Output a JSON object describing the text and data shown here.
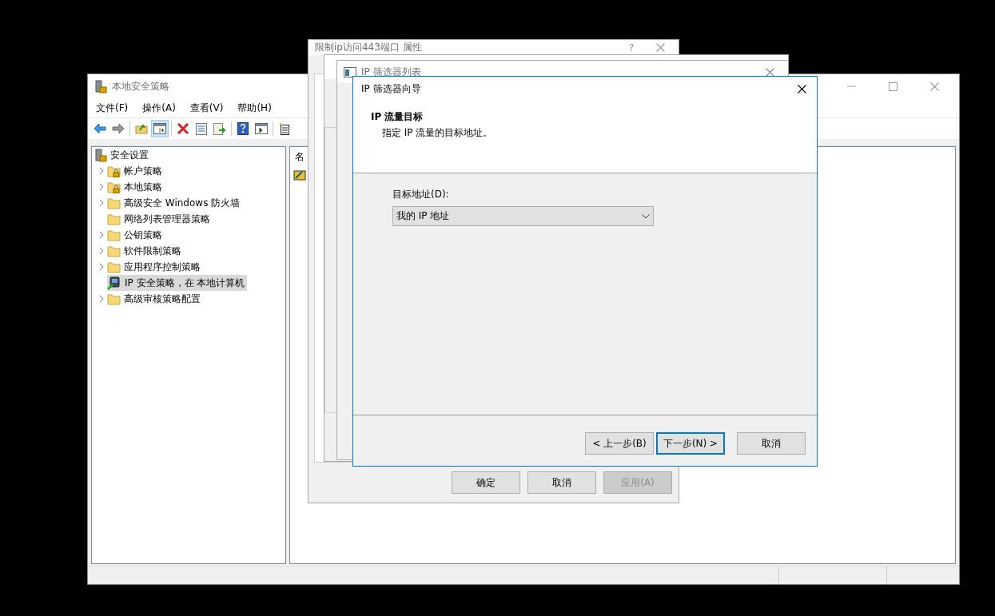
{
  "main_window": {
    "title": "本地安全策略",
    "menu": [
      "文件(F)",
      "操作(A)",
      "查看(V)",
      "帮助(H)"
    ],
    "tree": {
      "label": "安全设置",
      "children": [
        {
          "label": "帐户策略",
          "kind": "locked-folder",
          "expandable": true,
          "selected": false
        },
        {
          "label": "本地策略",
          "kind": "locked-folder",
          "expandable": true,
          "selected": false
        },
        {
          "label": "高级安全 Windows 防火墙",
          "kind": "folder",
          "expandable": true,
          "selected": false
        },
        {
          "label": "网络列表管理器策略",
          "kind": "folder",
          "expandable": false,
          "selected": false
        },
        {
          "label": "公钥策略",
          "kind": "folder",
          "expandable": true,
          "selected": false
        },
        {
          "label": "软件限制策略",
          "kind": "folder",
          "expandable": true,
          "selected": false
        },
        {
          "label": "应用程序控制策略",
          "kind": "folder",
          "expandable": true,
          "selected": false
        },
        {
          "label": "IP 安全策略，在 本地计算机",
          "kind": "ip-policy",
          "expandable": false,
          "selected": true
        },
        {
          "label": "高级审核策略配置",
          "kind": "folder",
          "expandable": true,
          "selected": false
        }
      ]
    },
    "list_column": "名"
  },
  "properties_dialog": {
    "title": "限制ip访问443端口 属性",
    "help": "?",
    "buttons": [
      {
        "label": "确定",
        "disabled": false
      },
      {
        "label": "取消",
        "disabled": false
      },
      {
        "label": "应用(A)",
        "disabled": true
      }
    ]
  },
  "filter_list_dialog": {
    "title": "IP 筛选器列表"
  },
  "wizard": {
    "title": "IP 筛选器向导",
    "heading": "IP 流量目标",
    "subheading": "指定 IP 流量的目标地址。",
    "field": {
      "label": "目标地址(D):",
      "value": "我的 IP 地址"
    },
    "buttons": [
      {
        "label": "< 上一步(B)",
        "focused": false
      },
      {
        "label": "下一步(N) >",
        "focused": true
      },
      {
        "label": "取消",
        "focused": false
      }
    ]
  }
}
